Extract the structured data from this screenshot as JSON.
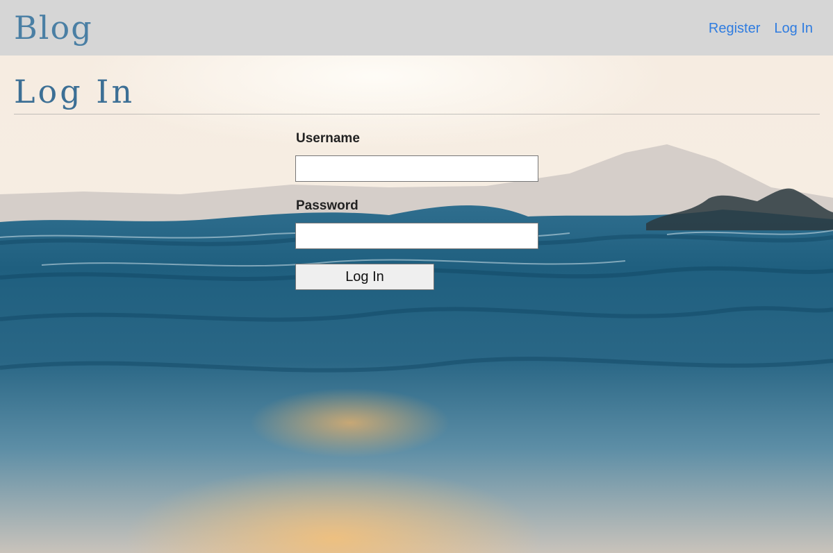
{
  "nav": {
    "brand": "Blog",
    "links": [
      {
        "label": "Register"
      },
      {
        "label": "Log In"
      }
    ]
  },
  "page": {
    "title": "Log In"
  },
  "form": {
    "username_label": "Username",
    "username_value": "",
    "password_label": "Password",
    "password_value": "",
    "submit_label": "Log In"
  },
  "colors": {
    "navbar_bg": "#d6d6d6",
    "brand": "#4a7fa4",
    "link": "#2f7ce0",
    "title": "#3c6f95"
  },
  "background_image": "ocean-waves-sunset"
}
